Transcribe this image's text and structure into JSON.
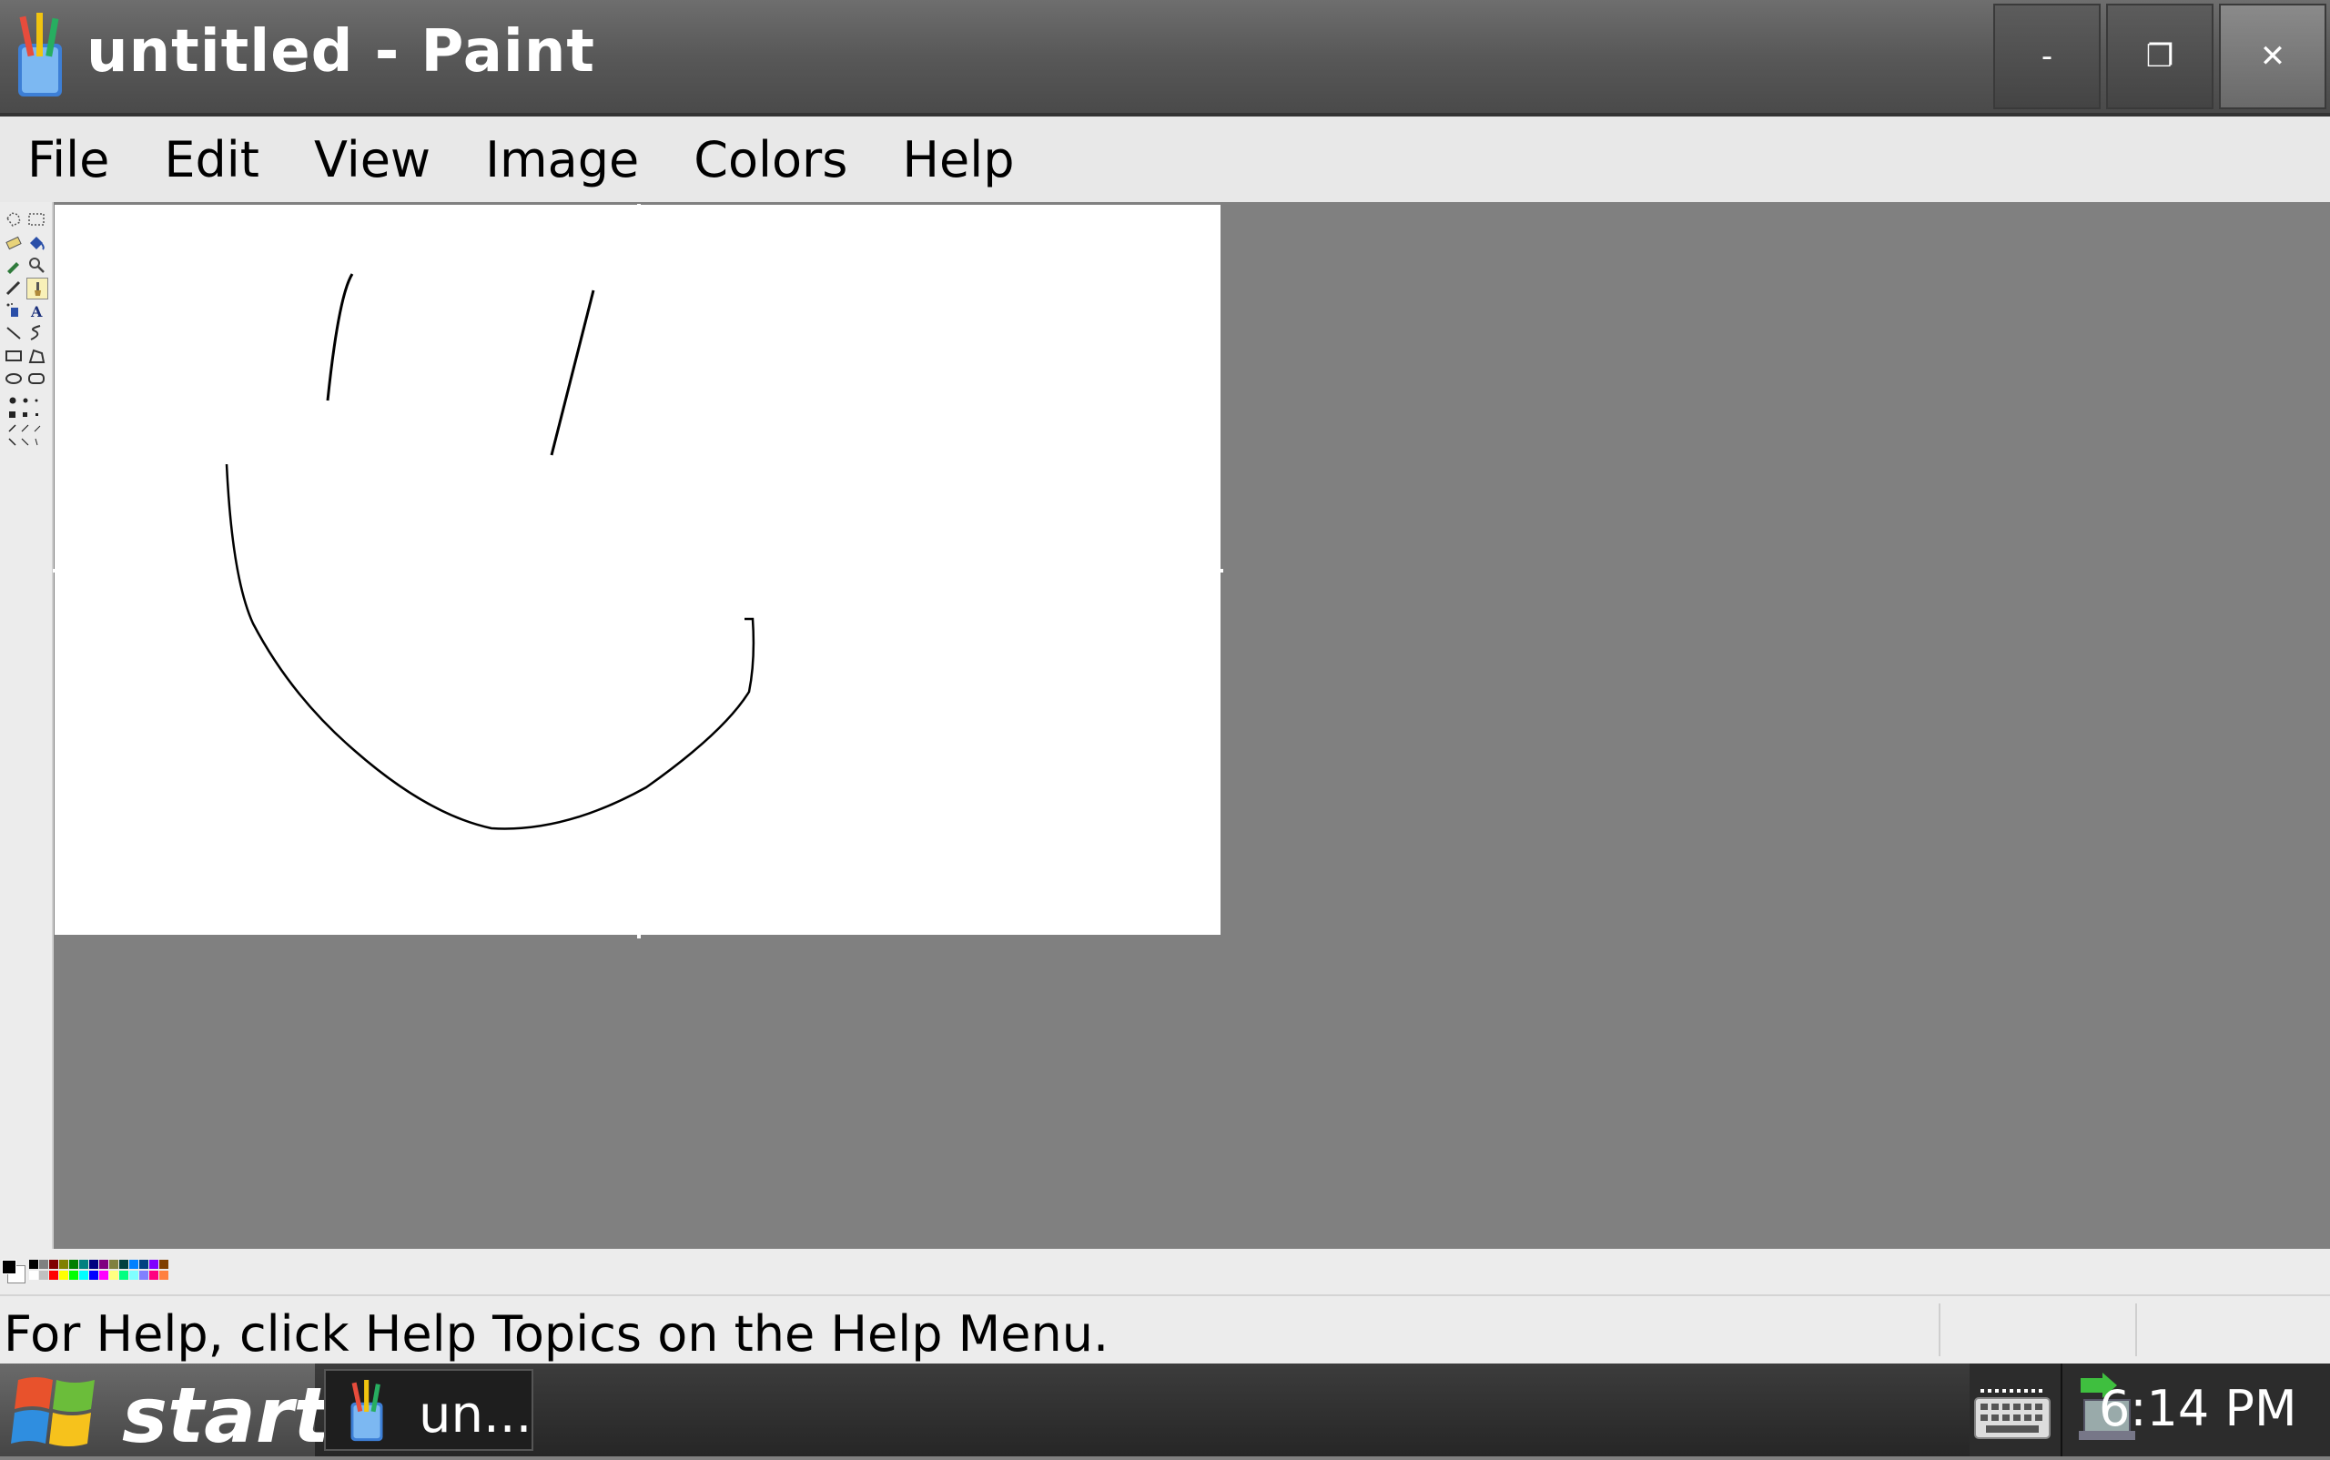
{
  "window": {
    "title": "untitled - Paint",
    "icon": "paint-brush-cup-icon",
    "minimize_label": "-",
    "restore_label": "❐",
    "close_label": "✕"
  },
  "menu": {
    "items": [
      "File",
      "Edit",
      "View",
      "Image",
      "Colors",
      "Help"
    ]
  },
  "toolbox": {
    "tools": [
      "free-select-icon",
      "rect-select-icon",
      "eraser-icon",
      "fill-icon",
      "color-picker-icon",
      "magnifier-icon",
      "pencil-icon",
      "brush-icon",
      "airbrush-icon",
      "text-icon",
      "line-icon",
      "curve-icon",
      "rectangle-icon",
      "polygon-icon",
      "ellipse-icon",
      "rounded-rect-icon"
    ]
  },
  "palette": {
    "foreground": "#000000",
    "background": "#ffffff",
    "colors_top": [
      "#000000",
      "#808080",
      "#800000",
      "#808000",
      "#008000",
      "#008080",
      "#000080",
      "#800080",
      "#808040",
      "#004040",
      "#0080ff",
      "#004080",
      "#8000ff",
      "#804000"
    ],
    "colors_bottom": [
      "#ffffff",
      "#c0c0c0",
      "#ff0000",
      "#ffff00",
      "#00ff00",
      "#00ffff",
      "#0000ff",
      "#ff00ff",
      "#ffff80",
      "#00ff80",
      "#80ffff",
      "#8080ff",
      "#ff0080",
      "#ff8040"
    ]
  },
  "status": {
    "help_text": "For Help, click Help Topics on the Help Menu."
  },
  "taskbar": {
    "start_label": "start",
    "task_label": "un...",
    "clock": "6:14 PM",
    "tray_icons": [
      "keyboard-icon",
      "network-icon"
    ]
  }
}
